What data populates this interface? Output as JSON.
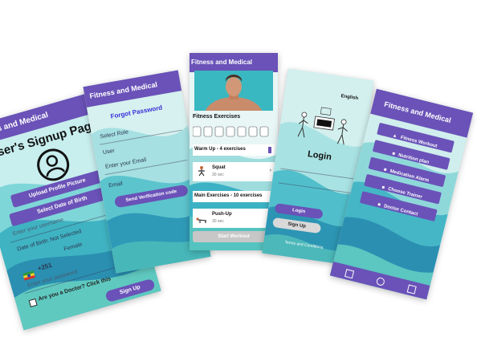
{
  "signup": {
    "header": "Fitness and Medical",
    "title": "User's Signup Page",
    "upload_label": "Upload Profile Picture",
    "dob_label": "Select Date of Birth",
    "username_placeholder": "Enter your username",
    "date_of_birth_text": "Date of Birth: Not Selected",
    "gender_text": "Female",
    "phone_code": "+251",
    "password_placeholder": "Enter your password",
    "doctor_question": "Are you a Doctor? Click this",
    "submit_label": "Sign Up"
  },
  "forgot": {
    "header": "Fitness and Medical",
    "title": "Forgot Password",
    "role_text": "Select Role",
    "user_text": "User",
    "email_placeholder": "Enter your Email",
    "email_label": "Email",
    "send_label": "Send Verification code"
  },
  "workout": {
    "header": "Fitness and Medical",
    "section_title": "Fitness Exercises",
    "warmup_label": "Warm Up - 4 exercises",
    "squat_name": "Squat",
    "squat_duration": "30 sec",
    "main_label": "Main Exercises - 10 exercises",
    "pushup_name": "Push-Up",
    "pushup_duration": "30 sec",
    "start_label": "Start Workout"
  },
  "login": {
    "language": "English",
    "title": "Login",
    "login_button": "Login",
    "signup_button": "Sign Up",
    "terms_text": "Terms and Conditions"
  },
  "menu": {
    "header": "Fitness and Medical",
    "items": [
      {
        "label": "Fitness Workout"
      },
      {
        "label": "Nutrition plan"
      },
      {
        "label": "Medication Alarm"
      },
      {
        "label": "Choose Trainer"
      },
      {
        "label": "Doctor Contact"
      }
    ]
  },
  "colors": {
    "primary": "#6a52b8",
    "teal": "#35b9c6",
    "light_teal": "#bfe9ea"
  }
}
